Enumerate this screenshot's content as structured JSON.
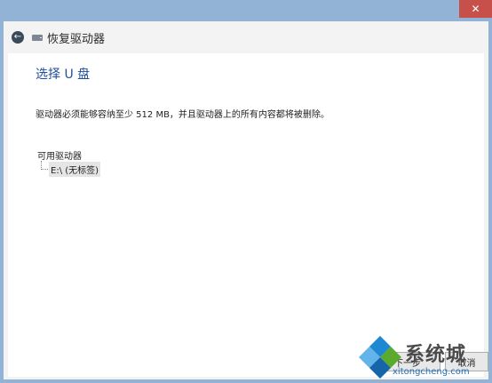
{
  "window": {
    "close_label": "✕"
  },
  "header": {
    "title": "恢复驱动器",
    "back_icon": "arrow-left-icon",
    "drive_icon": "usb-drive-icon"
  },
  "page": {
    "title": "选择 U 盘",
    "instruction": "驱动器必须能够容纳至少 512 MB，并且驱动器上的所有内容都将被删除。",
    "available_label": "可用驱动器",
    "drives": [
      "E:\\ (无标签)"
    ]
  },
  "footer": {
    "next_label": "下一步",
    "cancel_label": "取消"
  },
  "watermark": {
    "text": "系统城",
    "url": "xitongcheng.com"
  },
  "colors": {
    "accent_title": "#1f4e9c",
    "frame": "#93b3d6",
    "close": "#c7504b"
  }
}
